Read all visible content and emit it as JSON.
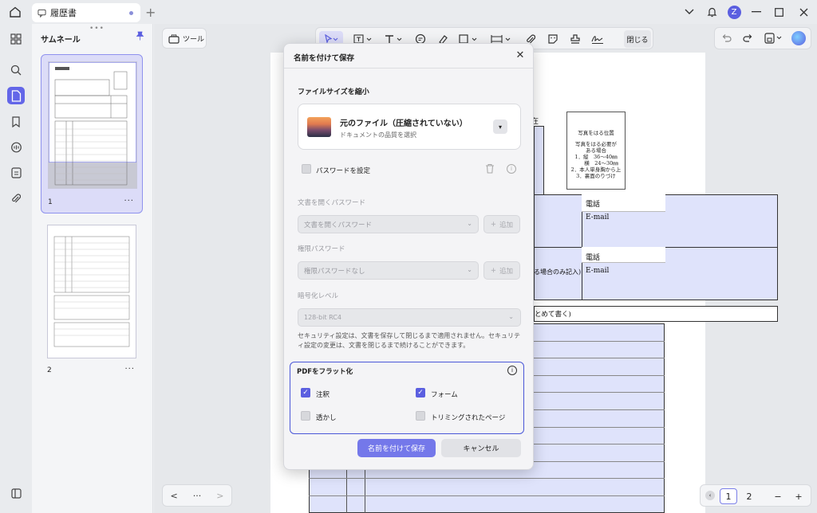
{
  "tab": {
    "title": "履歴書"
  },
  "window": {
    "avatar_letter": "Z"
  },
  "sidebar": {
    "panel_title": "サムネール",
    "pages": [
      {
        "num": "1"
      },
      {
        "num": "2"
      }
    ]
  },
  "toolbar": {
    "tools_label": "ツール",
    "close_label": "閉じる"
  },
  "document": {
    "fragment_1": "在",
    "photo_text": [
      "写真をはる位置",
      "",
      "写真をはる必要が",
      "ある場合",
      "1．縦　36〜40㎜",
      "　　横　24〜30㎜",
      "2．本人単身胸から上",
      "3．裏面のりづけ"
    ],
    "phone_label_1": "電話",
    "email_label_1": "E-mail",
    "phone_label_2": "電話",
    "email_label_2": "E-mail",
    "contact_note": "る場合のみ記入)",
    "history_note": "とめて書く)"
  },
  "dialog": {
    "title": "名前を付けて保存",
    "compress_section": "ファイルサイズを縮小",
    "file_option_name": "元のファイル（圧縮されていない）",
    "file_option_sub": "ドキュメントの品質を選択",
    "set_password_label": "パスワードを設定",
    "open_password_label": "文書を開くパスワード",
    "open_password_placeholder": "文書を開くパスワード",
    "add_label": "追加",
    "permission_password_label": "権限パスワード",
    "permission_password_placeholder": "権限パスワードなし",
    "encryption_label": "暗号化レベル",
    "encryption_value": "128-bit RC4",
    "security_note": "セキュリティ設定は、文書を保存して閉じるまで適用されません。セキュリティ設定の変更は、文書を閉じるまで続けることができます。",
    "flatten_title": "PDFをフラット化",
    "flatten_options": [
      {
        "label": "注釈",
        "checked": true
      },
      {
        "label": "フォーム",
        "checked": true
      },
      {
        "label": "透かし",
        "checked": false
      },
      {
        "label": "トリミングされたページ",
        "checked": false
      }
    ],
    "save_button": "名前を付けて保存",
    "cancel_button": "キャンセル"
  },
  "nav": {
    "prev": "<",
    "dots": "···",
    "next": ">"
  },
  "pagination": {
    "page1": "1",
    "page2": "2",
    "zoom_out": "−",
    "zoom_in": "+"
  },
  "colors": {
    "accent": "#5b5fe0",
    "flatten_border": "#4a57d8",
    "form_fill": "#dfe3fb"
  }
}
